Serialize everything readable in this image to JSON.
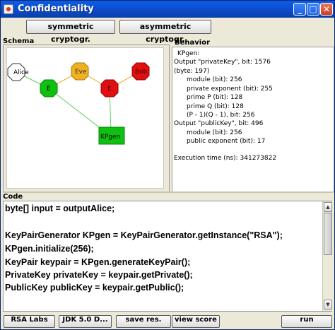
{
  "window": {
    "title": "Confidentiality",
    "minimize_glyph": "_",
    "maximize_glyph": "□",
    "close_glyph": "✕"
  },
  "top_buttons": {
    "symmetric": "symmetric cryptogr.",
    "asymmetric": "asymmetric cryptogr."
  },
  "schema": {
    "label": "Schema",
    "nodes": {
      "alice": "Alice",
      "eve": "Eve",
      "bob": "Bob",
      "e": "E",
      "kpgen": "KPgen"
    }
  },
  "behavior": {
    "label": "Behavior",
    "lines": [
      "KPgen:",
      "Output \"privateKey\", bit: 1576",
      "(byte: 197)",
      "module (bit): 256",
      "private exponent (bit): 255",
      "prime P (bit): 128",
      "prime Q (bit): 128",
      "(P - 1)(Q - 1), bit: 256",
      "Output \"publicKey\", bit: 496",
      "module (bit): 256",
      "public exponent (bit): 17",
      "",
      "Execution time (ns): 341273822"
    ]
  },
  "code": {
    "label": "Code",
    "lines": [
      "byte[] input = outputAlice;",
      "",
      "KeyPairGenerator KPgen = KeyPairGenerator.getInstance(\"RSA\");",
      "KPgen.initialize(256);",
      "KeyPair keypair = KPgen.generateKeyPair();",
      "PrivateKey privateKey = keypair.getPrivate();",
      "PublicKey publicKey = keypair.getPublic();"
    ]
  },
  "bottom_buttons": {
    "rsa": "RSA Labs",
    "jdk": "JDK 5.0 D...",
    "save": "save res.",
    "score": "view score",
    "run": "run"
  },
  "colors": {
    "eve": "#f0b020",
    "bob": "#e01010",
    "e": "#10c010",
    "kpgen": "#10c010",
    "alice": "#ffffff"
  }
}
